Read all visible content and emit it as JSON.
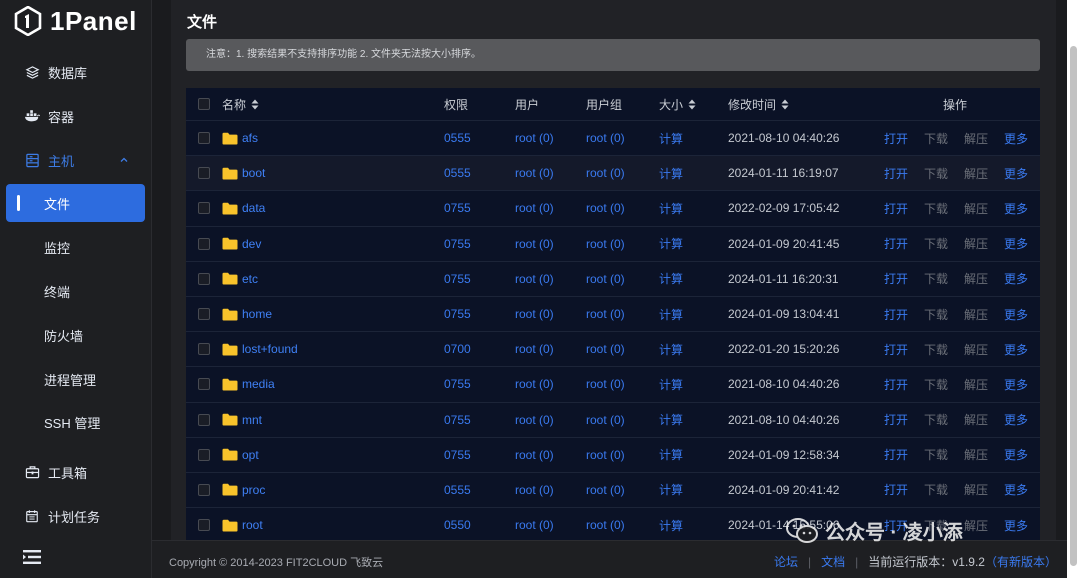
{
  "app": {
    "name": "1Panel"
  },
  "sidebar": {
    "items": [
      {
        "label": "数据库",
        "icon": "layers-icon"
      },
      {
        "label": "容器",
        "icon": "docker-icon"
      },
      {
        "label": "主机",
        "icon": "server-icon",
        "expanded": true
      },
      {
        "label": "文件",
        "active": true
      },
      {
        "label": "监控"
      },
      {
        "label": "终端"
      },
      {
        "label": "防火墙"
      },
      {
        "label": "进程管理"
      },
      {
        "label": "SSH 管理"
      },
      {
        "label": "工具箱",
        "icon": "toolbox-icon"
      },
      {
        "label": "计划任务",
        "icon": "calendar-icon"
      }
    ],
    "menu_icon": "hamburger-icon"
  },
  "page": {
    "title": "文件",
    "notice": "注意：1. 搜索结果不支持排序功能 2. 文件夹无法按大小排序。"
  },
  "table": {
    "columns": {
      "name": "名称",
      "perm": "权限",
      "user": "用户",
      "group": "用户组",
      "size": "大小",
      "time": "修改时间",
      "ops": "操作"
    },
    "op_labels": {
      "open": "打开",
      "download": "下载",
      "extract": "解压",
      "more": "更多"
    },
    "rows": [
      {
        "name": "afs",
        "perm": "0555",
        "user": "root (0)",
        "group": "root (0)",
        "size": "计算",
        "time": "2021-08-10 04:40:26"
      },
      {
        "name": "boot",
        "perm": "0555",
        "user": "root (0)",
        "group": "root (0)",
        "size": "计算",
        "time": "2024-01-11 16:19:07"
      },
      {
        "name": "data",
        "perm": "0755",
        "user": "root (0)",
        "group": "root (0)",
        "size": "计算",
        "time": "2022-02-09 17:05:42"
      },
      {
        "name": "dev",
        "perm": "0755",
        "user": "root (0)",
        "group": "root (0)",
        "size": "计算",
        "time": "2024-01-09 20:41:45"
      },
      {
        "name": "etc",
        "perm": "0755",
        "user": "root (0)",
        "group": "root (0)",
        "size": "计算",
        "time": "2024-01-11 16:20:31"
      },
      {
        "name": "home",
        "perm": "0755",
        "user": "root (0)",
        "group": "root (0)",
        "size": "计算",
        "time": "2024-01-09 13:04:41"
      },
      {
        "name": "lost+found",
        "perm": "0700",
        "user": "root (0)",
        "group": "root (0)",
        "size": "计算",
        "time": "2022-01-20 15:20:26"
      },
      {
        "name": "media",
        "perm": "0755",
        "user": "root (0)",
        "group": "root (0)",
        "size": "计算",
        "time": "2021-08-10 04:40:26"
      },
      {
        "name": "mnt",
        "perm": "0755",
        "user": "root (0)",
        "group": "root (0)",
        "size": "计算",
        "time": "2021-08-10 04:40:26"
      },
      {
        "name": "opt",
        "perm": "0755",
        "user": "root (0)",
        "group": "root (0)",
        "size": "计算",
        "time": "2024-01-09 12:58:34"
      },
      {
        "name": "proc",
        "perm": "0555",
        "user": "root (0)",
        "group": "root (0)",
        "size": "计算",
        "time": "2024-01-09 20:41:42"
      },
      {
        "name": "root",
        "perm": "0550",
        "user": "root (0)",
        "group": "root (0)",
        "size": "计算",
        "time": "2024-01-14 15:55:06"
      }
    ]
  },
  "footer": {
    "copyright": "Copyright © 2014-2023 FIT2CLOUD 飞致云",
    "forum": "论坛",
    "docs": "文档",
    "version_label": "当前运行版本：v1.9.2",
    "new_version": "（有新版本）"
  },
  "watermark": {
    "text": "公众号 · 凌小添"
  },
  "colors": {
    "accent": "#2d6cdf",
    "link": "#3a7af0",
    "folder": "#f8c32b"
  }
}
